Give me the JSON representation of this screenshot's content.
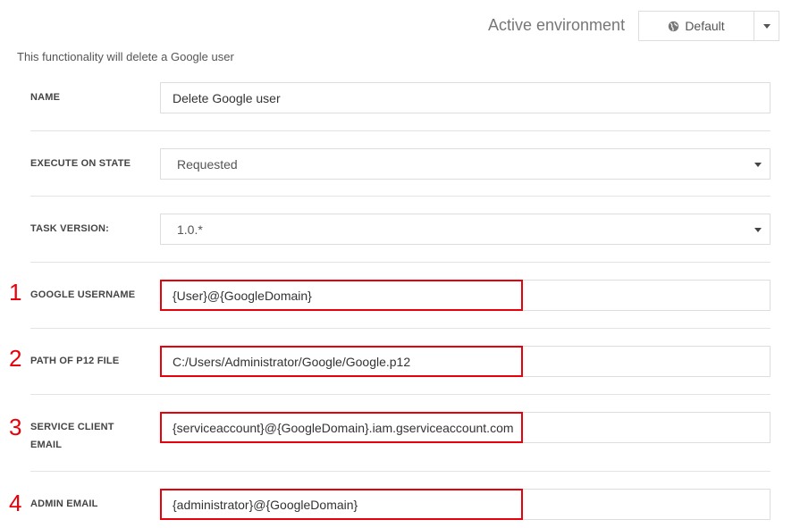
{
  "header": {
    "env_label": "Active environment",
    "env_value": "Default",
    "env_icon": "globe-icon"
  },
  "description": "This functionality will delete a Google user",
  "form": {
    "name": {
      "label": "NAME",
      "value": "Delete Google user"
    },
    "execute_on_state": {
      "label": "EXECUTE ON STATE",
      "value": "Requested"
    },
    "task_version": {
      "label": "TASK VERSION:",
      "value": "1.0.*"
    },
    "google_username": {
      "label": "GOOGLE USERNAME",
      "value": "{User}@{GoogleDomain}",
      "step": "1"
    },
    "p12_path": {
      "label": "PATH OF P12 FILE",
      "value": "C:/Users/Administrator/Google/Google.p12",
      "step": "2"
    },
    "service_client_email": {
      "label_line1": "SERVICE CLIENT",
      "label_line2": "EMAIL",
      "value": "{serviceaccount}@{GoogleDomain}.iam.gserviceaccount.com",
      "step": "3"
    },
    "admin_email": {
      "label": "ADMIN EMAIL",
      "value": "{administrator}@{GoogleDomain}",
      "step": "4"
    }
  },
  "colors": {
    "highlight": "#e8000b",
    "border": "#dddddd",
    "divider": "#e3e3e3"
  }
}
